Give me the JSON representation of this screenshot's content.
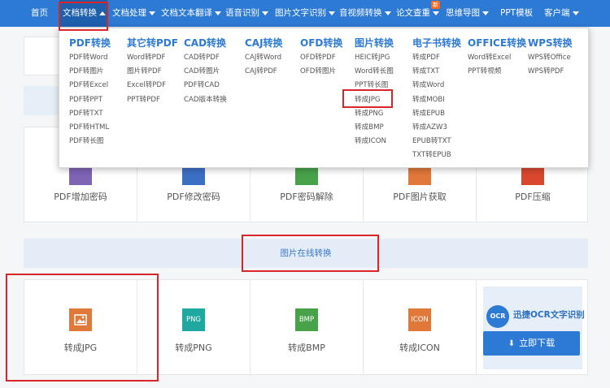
{
  "nav": {
    "items": [
      {
        "label": "首页",
        "caret": false
      },
      {
        "label": "文档转换",
        "caret": true
      },
      {
        "label": "文档处理",
        "caret": true
      },
      {
        "label": "文档文本翻译",
        "caret": true
      },
      {
        "label": "语音识别",
        "caret": true
      },
      {
        "label": "图片文字识别",
        "caret": true
      },
      {
        "label": "音视频转换",
        "caret": true
      },
      {
        "label": "论文查重",
        "caret": true
      },
      {
        "label": "思维导图",
        "caret": true
      },
      {
        "label": "PPT模板",
        "caret": false
      },
      {
        "label": "客户端",
        "caret": true
      }
    ],
    "badge": "新",
    "active_index": 1
  },
  "dropdown": {
    "columns": [
      {
        "title": "PDF转换",
        "items": [
          "PDF转Word",
          "PDF转图片",
          "PDF转Excel",
          "PDF转PPT",
          "PDF转TXT",
          "PDF转HTML",
          "PDF转长图"
        ]
      },
      {
        "title": "其它转PDF",
        "items": [
          "Word转PDF",
          "图片转PDF",
          "Excel转PDF",
          "PPT转PDF"
        ]
      },
      {
        "title": "CAD转换",
        "items": [
          "CAD转PDF",
          "CAD转图片",
          "PDF转CAD",
          "CAD版本转换"
        ]
      },
      {
        "title": "CAJ转换",
        "items": [
          "CAJ转Word",
          "CAJ转PDF"
        ]
      },
      {
        "title": "OFD转换",
        "items": [
          "OFD转PDF",
          "OFD转图片"
        ]
      },
      {
        "title": "图片转换",
        "items": [
          "HEIC转JPG",
          "Word转长图",
          "PPT转长图",
          "转成JPG",
          "转成PNG",
          "转成BMP",
          "转成ICON"
        ]
      },
      {
        "title": "电子书转换",
        "items": [
          "转成PDF",
          "转成TXT",
          "转成Word",
          "转成MOBI",
          "转成EPUB",
          "转成AZW3",
          "EPUB转TXT",
          "TXT转EPUB"
        ]
      },
      {
        "title": "OFFICE转换",
        "items": [
          "Word转Excel",
          "PPT转视频"
        ]
      },
      {
        "title": "WPS转换",
        "items": [
          "WPS转Office",
          "WPS转PDF"
        ]
      }
    ]
  },
  "pdf_tools": {
    "labels": [
      "PDF增加密码",
      "PDF修改密码",
      "PDF密码解除",
      "PDF图片获取",
      "PDF压缩"
    ]
  },
  "section": {
    "title": "图片在线转换"
  },
  "image_tools": {
    "items": [
      {
        "label": "转成JPG",
        "icon": "image-icon",
        "color": "#e0783a",
        "glyph": ""
      },
      {
        "label": "转成PNG",
        "icon": "png-icon",
        "color": "#1ea8a0",
        "glyph": "PNG"
      },
      {
        "label": "转成BMP",
        "icon": "bmp-icon",
        "color": "#48a24a",
        "glyph": "BMP"
      },
      {
        "label": "转成ICON",
        "icon": "icon-file-icon",
        "color": "#e0783a",
        "glyph": "ICON"
      }
    ]
  },
  "ocr": {
    "logo": "OCR",
    "title": "迅捷OCR文字识别",
    "download": "立即下载"
  },
  "colors": {
    "nav": "#2d7ad4",
    "accent": "#2d7ad4",
    "highlight_border": "#d9252a"
  }
}
